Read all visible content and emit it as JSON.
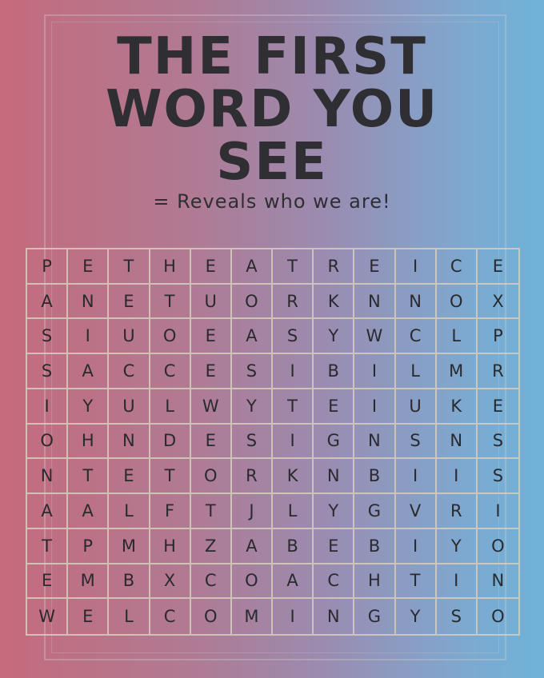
{
  "title_lines": [
    "THE FIRST",
    "WORD YOU",
    "SEE"
  ],
  "subtitle": "= Reveals who we are!",
  "grid": [
    [
      "P",
      "E",
      "T",
      "H",
      "E",
      "A",
      "T",
      "R",
      "E",
      "I",
      "C",
      "E"
    ],
    [
      "A",
      "N",
      "E",
      "T",
      "U",
      "O",
      "R",
      "K",
      "N",
      "N",
      "O",
      "X"
    ],
    [
      "S",
      "I",
      "U",
      "O",
      "E",
      "A",
      "S",
      "Y",
      "W",
      "C",
      "L",
      "P"
    ],
    [
      "S",
      "A",
      "C",
      "C",
      "E",
      "S",
      "I",
      "B",
      "I",
      "L",
      "M",
      "R"
    ],
    [
      "I",
      "Y",
      "U",
      "L",
      "W",
      "Y",
      "T",
      "E",
      "I",
      "U",
      "K",
      "E"
    ],
    [
      "O",
      "H",
      "N",
      "D",
      "E",
      "S",
      "I",
      "G",
      "N",
      "S",
      "N",
      "S"
    ],
    [
      "N",
      "T",
      "E",
      "T",
      "O",
      "R",
      "K",
      "N",
      "B",
      "I",
      "I",
      "S"
    ],
    [
      "A",
      "A",
      "L",
      "F",
      "T",
      "J",
      "L",
      "Y",
      "G",
      "V",
      "R",
      "I"
    ],
    [
      "T",
      "P",
      "M",
      "H",
      "Z",
      "A",
      "B",
      "E",
      "B",
      "I",
      "Y",
      "O"
    ],
    [
      "E",
      "M",
      "B",
      "X",
      "C",
      "O",
      "A",
      "C",
      "H",
      "T",
      "I",
      "N"
    ],
    [
      "W",
      "E",
      "L",
      "C",
      "O",
      "M",
      "I",
      "N",
      "G",
      "Y",
      "S",
      "O"
    ]
  ]
}
